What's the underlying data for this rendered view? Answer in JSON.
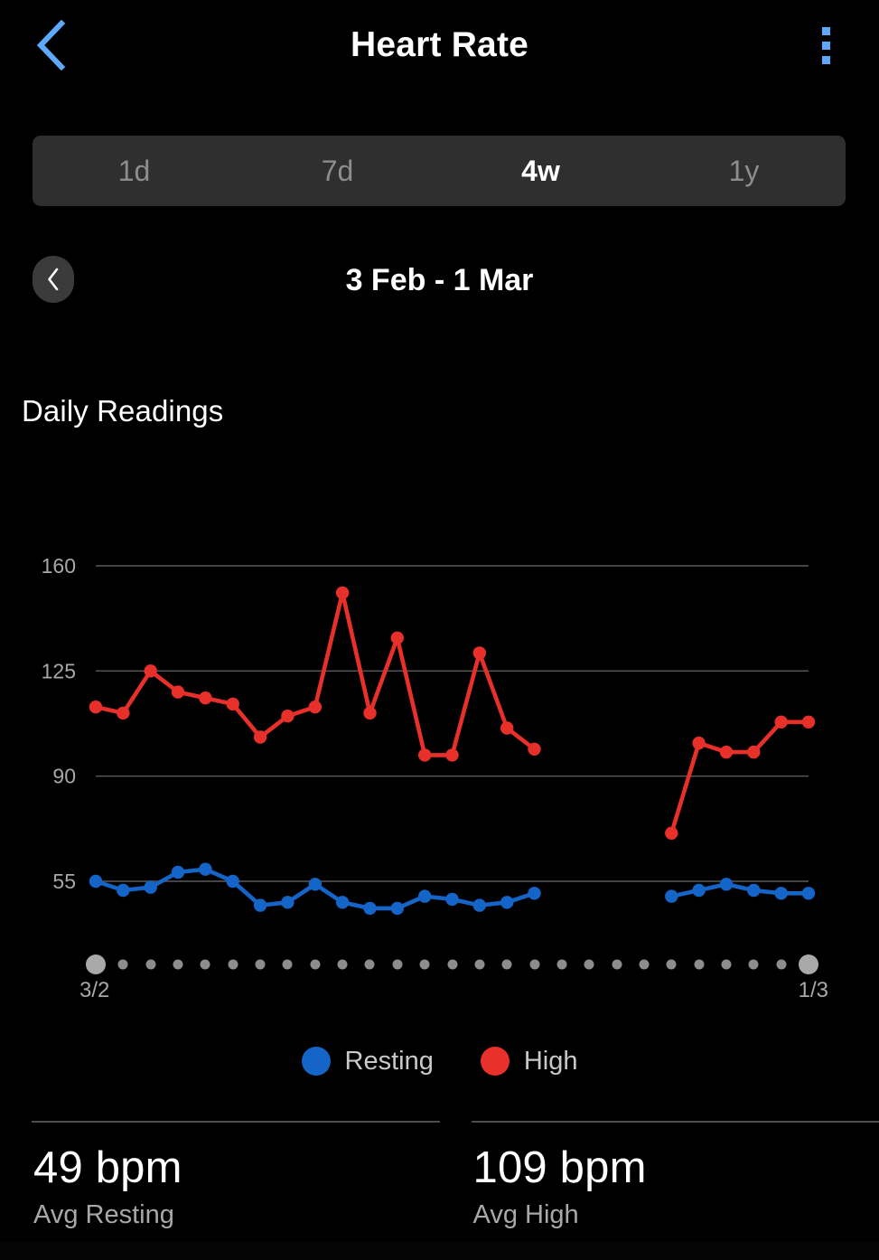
{
  "appbar": {
    "title": "Heart Rate",
    "back_icon": "chevron-left-icon",
    "overflow_icon": "more-vertical-icon",
    "accent": "#5ea9fb"
  },
  "range_tabs": {
    "selected": "4w",
    "items": [
      {
        "label": "1d",
        "selected": false
      },
      {
        "label": "7d",
        "selected": false
      },
      {
        "label": "4w",
        "selected": true
      },
      {
        "label": "1y",
        "selected": false
      }
    ]
  },
  "date_nav": {
    "prev_icon": "chevron-left-icon",
    "range_label": "3 Feb - 1 Mar"
  },
  "section": {
    "title": "Daily Readings"
  },
  "legend": [
    {
      "label": "Resting",
      "color": "#1565C9",
      "key": "resting"
    },
    {
      "label": "High",
      "color": "#E8302A",
      "key": "high"
    }
  ],
  "axis": {
    "start_label": "3/2",
    "end_label": "1/3",
    "dot_count": 27,
    "edge_dots": [
      0,
      26
    ]
  },
  "stats": [
    {
      "value": "49 bpm",
      "label": "Avg Resting"
    },
    {
      "value": "109 bpm",
      "label": "Avg High"
    }
  ],
  "chart_data": {
    "type": "line",
    "title": "Daily Readings",
    "xlabel": "",
    "ylabel": "bpm",
    "ylim": [
      40,
      172
    ],
    "yticks": [
      160,
      125,
      90,
      55
    ],
    "grid": true,
    "legend_position": "bottom-center",
    "x_start_label": "3/2",
    "x_end_label": "1/3",
    "x_count": 27,
    "series": [
      {
        "name": "High",
        "color": "#E8302A",
        "values": [
          113,
          111,
          125,
          118,
          116,
          114,
          103,
          110,
          113,
          151,
          111,
          136,
          97,
          97,
          131,
          106,
          99,
          null,
          null,
          null,
          null,
          71,
          101,
          98,
          98,
          108,
          108
        ]
      },
      {
        "name": "Resting",
        "color": "#1565C9",
        "values": [
          55,
          52,
          53,
          58,
          59,
          55,
          47,
          48,
          54,
          48,
          46,
          46,
          50,
          49,
          47,
          48,
          51,
          null,
          null,
          null,
          null,
          50,
          52,
          54,
          52,
          51,
          51
        ]
      }
    ]
  }
}
